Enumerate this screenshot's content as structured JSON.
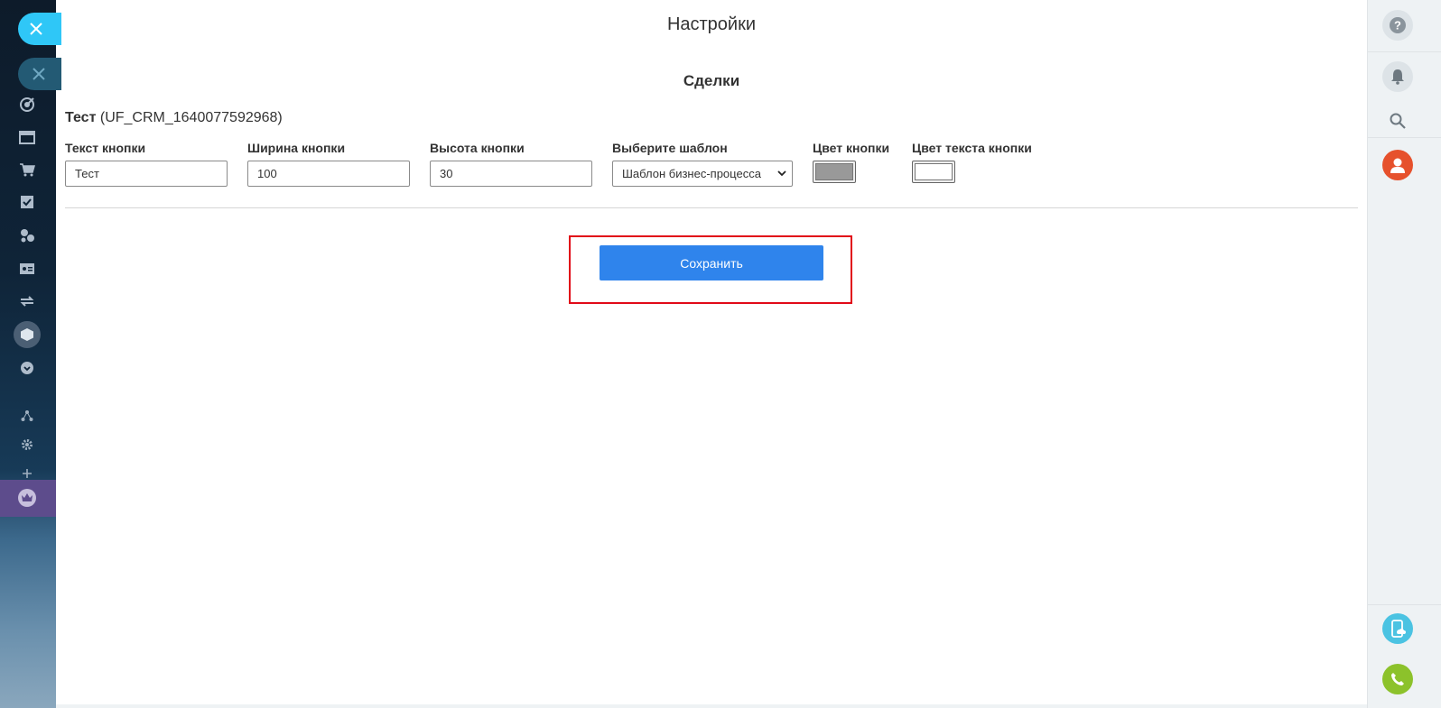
{
  "header": {
    "title": "Настройки"
  },
  "section": {
    "title": "Сделки"
  },
  "field": {
    "name": "Тест",
    "code": "(UF_CRM_1640077592968)"
  },
  "form": {
    "button_text": {
      "label": "Текст кнопки",
      "value": "Тест"
    },
    "button_width": {
      "label": "Ширина кнопки",
      "value": "100"
    },
    "button_height": {
      "label": "Высота кнопки",
      "value": "30"
    },
    "template": {
      "label": "Выберите шаблон",
      "selected": "Шаблон бизнес-процесса"
    },
    "button_color": {
      "label": "Цвет кнопки",
      "value": "#999999"
    },
    "button_text_color": {
      "label": "Цвет текста кнопки",
      "value": "#ffffff"
    }
  },
  "actions": {
    "save_label": "Сохранить"
  },
  "colors": {
    "accent": "#2f84ec",
    "highlight_border": "#e10a18",
    "close_tab": "#2fc7f7",
    "avatar": "#e6512c",
    "cloud_button": "#4bc3e2",
    "phone_button": "#8cc22b"
  },
  "left_sidebar": {
    "icons": [
      "close-icon",
      "target-icon",
      "calendar-icon",
      "cart-icon",
      "tasks-icon",
      "crm-icon",
      "contact-card-icon",
      "sync-icon",
      "box-icon",
      "chevron-down-icon",
      "sitemap-icon",
      "gear-icon",
      "plus-icon",
      "crown-icon"
    ]
  },
  "right_sidebar": {
    "icons": [
      "help-icon",
      "bell-icon",
      "search-icon",
      "user-avatar-icon",
      "cloud-phone-icon",
      "phone-icon"
    ]
  }
}
